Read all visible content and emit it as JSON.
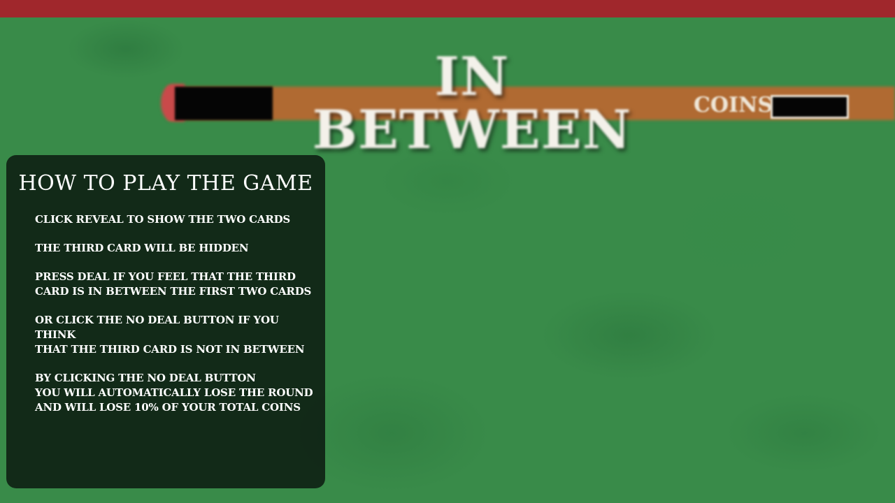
{
  "game": {
    "title": "IN BETWEEN",
    "coins_label": "COINS",
    "coins_value": ""
  },
  "colors": {
    "top_bar": "#a0272c",
    "felt": "#398b49",
    "hud_strip": "#b06a32",
    "panel": "#0c1a10"
  },
  "how_to_play": {
    "title": "HOW TO PLAY THE GAME",
    "steps": [
      "CLICK REVEAL TO SHOW THE TWO CARDS",
      "THE THIRD CARD WILL BE HIDDEN",
      "PRESS DEAL IF YOU FEEL THAT THE THIRD\nCARD IS IN BETWEEN THE FIRST TWO CARDS",
      "OR CLICK THE NO DEAL BUTTON IF YOU THINK\nTHAT THE THIRD CARD IS NOT IN BETWEEN",
      "BY CLICKING THE NO DEAL BUTTON\nYOU WILL AUTOMATICALLY LOSE THE ROUND\nAND WILL LOSE 10% OF YOUR TOTAL COINS"
    ]
  }
}
